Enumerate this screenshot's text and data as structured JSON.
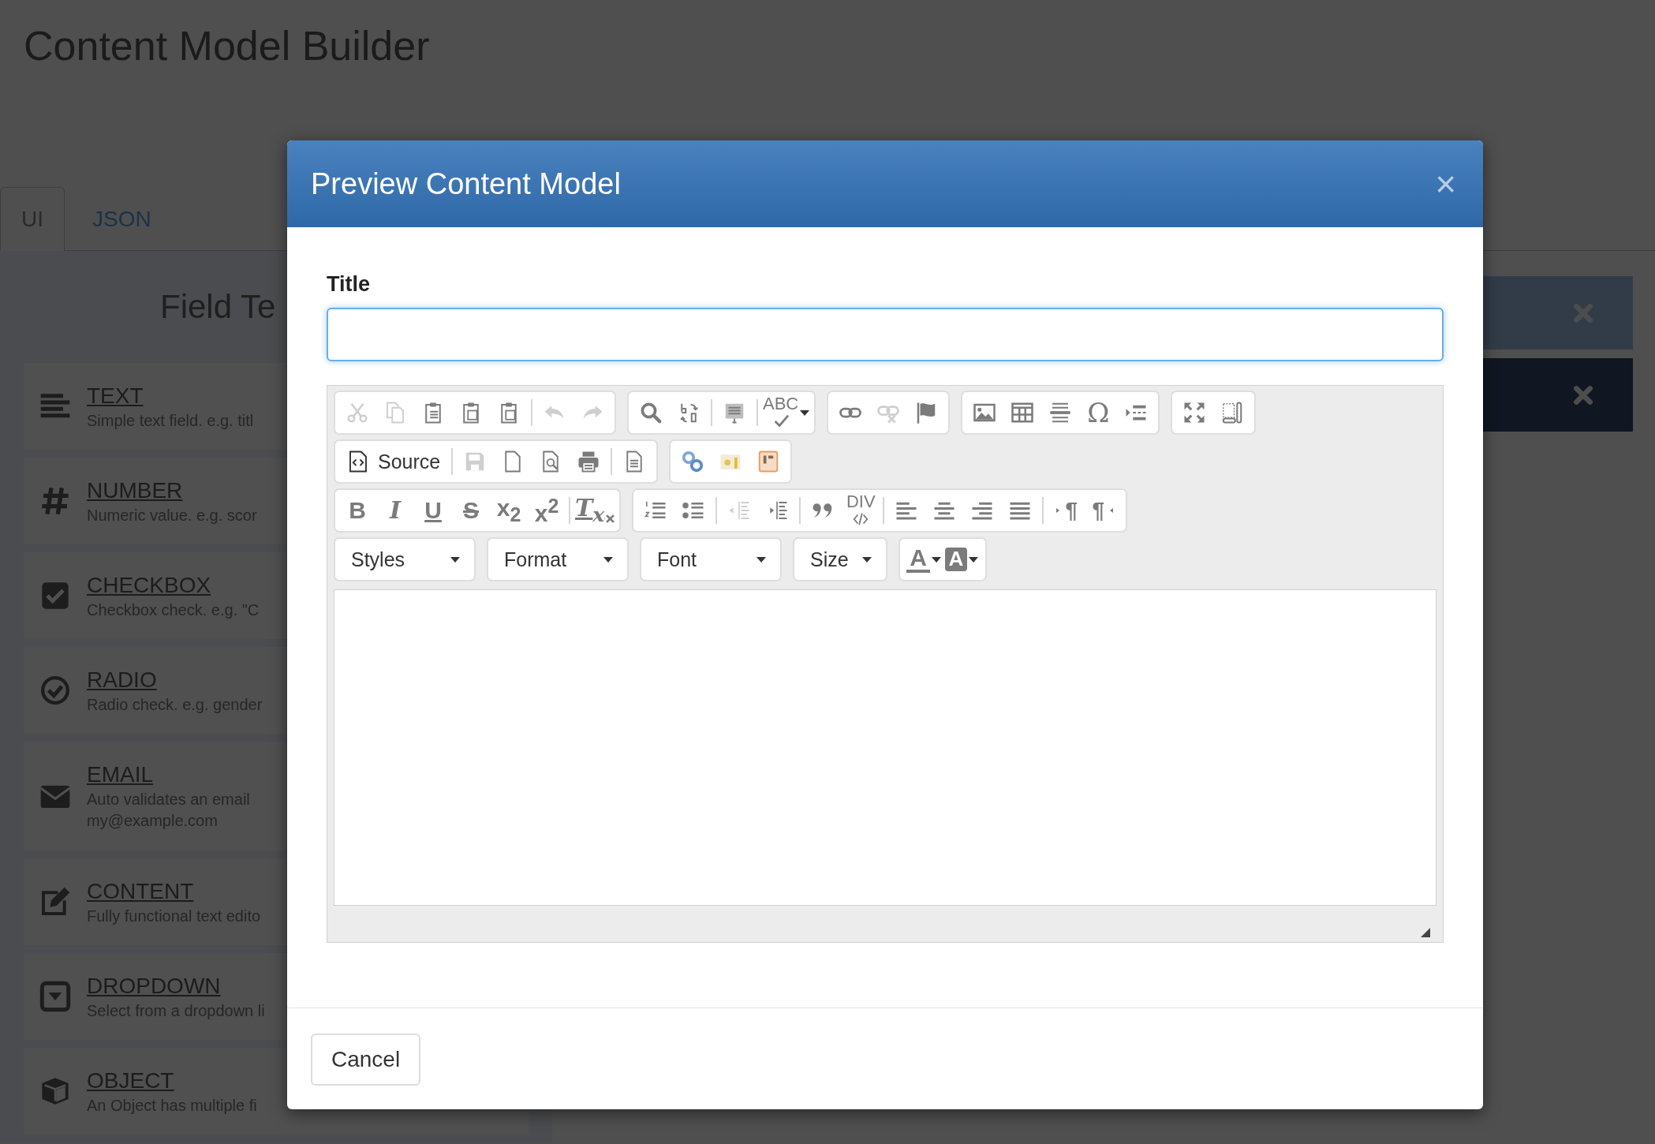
{
  "page": {
    "title": "Content Model Builder"
  },
  "tabs": [
    {
      "label": "UI",
      "selected": true
    },
    {
      "label": "JSON",
      "selected": false
    }
  ],
  "field_templates": {
    "heading": "Field Te",
    "items": [
      {
        "name": "TEXT",
        "description": [
          "Simple text field. e.g. titl"
        ]
      },
      {
        "name": "NUMBER",
        "description": [
          "Numeric value. e.g. scor"
        ]
      },
      {
        "name": "CHECKBOX",
        "description": [
          "Checkbox check. e.g. \"C"
        ]
      },
      {
        "name": "RADIO",
        "description": [
          "Radio check. e.g. gender"
        ]
      },
      {
        "name": "EMAIL",
        "description": [
          "Auto validates an email",
          "my@example.com"
        ]
      },
      {
        "name": "CONTENT",
        "description": [
          "Fully functional text edito"
        ]
      },
      {
        "name": "DROPDOWN",
        "description": [
          "Select from a dropdown li"
        ]
      },
      {
        "name": "OBJECT",
        "description": [
          "An Object has multiple fi"
        ]
      }
    ]
  },
  "side_panels": [
    {
      "color": "#323c48"
    },
    {
      "color": "#101722"
    }
  ],
  "modal": {
    "title": "Preview Content Model",
    "close": "×",
    "field_label": "Title",
    "toolbar": [
      [
        {
          "items": [
            {
              "kind": "button",
              "disabled": true
            },
            {
              "kind": "button",
              "disabled": true
            },
            {
              "kind": "button",
              "disabled": false
            },
            {
              "kind": "button",
              "disabled": false
            },
            {
              "kind": "button",
              "disabled": false
            },
            {
              "kind": "separator"
            },
            {
              "kind": "button",
              "disabled": true
            },
            {
              "kind": "button",
              "disabled": true
            }
          ]
        },
        {
          "items": [
            {
              "kind": "button",
              "disabled": false
            },
            {
              "kind": "button",
              "disabled": false
            },
            {
              "kind": "separator"
            },
            {
              "kind": "button",
              "disabled": false
            },
            {
              "kind": "separator"
            },
            {
              "kind": "menu-button",
              "disabled": false,
              "glyph": "ABC"
            }
          ]
        },
        {
          "items": [
            {
              "kind": "button",
              "disabled": false
            },
            {
              "kind": "button",
              "disabled": true
            },
            {
              "kind": "button",
              "disabled": false
            }
          ]
        },
        {
          "items": [
            {
              "kind": "button",
              "disabled": false
            },
            {
              "kind": "button",
              "disabled": false
            },
            {
              "kind": "button",
              "disabled": false
            },
            {
              "kind": "button",
              "disabled": false,
              "glyph": "Ω"
            },
            {
              "kind": "button",
              "disabled": false
            }
          ]
        },
        {
          "items": [
            {
              "kind": "button",
              "disabled": false
            },
            {
              "kind": "button",
              "disabled": false
            }
          ]
        }
      ],
      [
        {
          "items": [
            {
              "kind": "source",
              "disabled": false,
              "label": "Source"
            },
            {
              "kind": "separator"
            },
            {
              "kind": "button",
              "disabled": true
            },
            {
              "kind": "button",
              "disabled": false
            },
            {
              "kind": "button",
              "disabled": false
            },
            {
              "kind": "button",
              "disabled": false
            },
            {
              "kind": "separator"
            },
            {
              "kind": "button",
              "disabled": false
            }
          ]
        },
        {
          "items": [
            {
              "kind": "button",
              "disabled": false
            },
            {
              "kind": "button",
              "disabled": false
            },
            {
              "kind": "button",
              "disabled": false
            }
          ]
        }
      ],
      [
        {
          "items": [
            {
              "kind": "button",
              "disabled": false,
              "glyph": "B"
            },
            {
              "kind": "button",
              "disabled": false,
              "glyph": "I"
            },
            {
              "kind": "button",
              "disabled": false,
              "glyph": "U"
            },
            {
              "kind": "button",
              "disabled": false,
              "glyph": "S"
            },
            {
              "kind": "button",
              "disabled": false,
              "glyph": "x$_{2}$"
            },
            {
              "kind": "button",
              "disabled": false,
              "glyph": "x$^{2}$"
            },
            {
              "kind": "separator"
            },
            {
              "kind": "button",
              "disabled": false,
              "glyph": "T$_{x}$"
            }
          ]
        },
        {
          "items": [
            {
              "kind": "button",
              "disabled": false
            },
            {
              "kind": "button",
              "disabled": false
            },
            {
              "kind": "separator"
            },
            {
              "kind": "button",
              "disabled": true
            },
            {
              "kind": "button",
              "disabled": false
            },
            {
              "kind": "separator"
            },
            {
              "kind": "button",
              "disabled": false
            },
            {
              "kind": "button",
              "disabled": false,
              "glyph": "DIV"
            },
            {
              "kind": "separator"
            },
            {
              "kind": "button",
              "disabled": false
            },
            {
              "kind": "button",
              "disabled": false
            },
            {
              "kind": "button",
              "disabled": false
            },
            {
              "kind": "button",
              "disabled": false
            },
            {
              "kind": "separator"
            },
            {
              "kind": "button",
              "disabled": false,
              "glyph": "¶"
            },
            {
              "kind": "button",
              "disabled": false,
              "glyph": "¶"
            }
          ]
        }
      ],
      [
        {
          "items": [
            {
              "kind": "combo",
              "label": "Styles"
            }
          ]
        },
        {
          "items": [
            {
              "kind": "combo",
              "label": "Format"
            }
          ]
        },
        {
          "items": [
            {
              "kind": "combo",
              "label": "Font"
            }
          ]
        },
        {
          "items": [
            {
              "kind": "combo",
              "label": "Size"
            }
          ]
        },
        {
          "items": [
            {
              "kind": "color",
              "glyph": "A"
            },
            {
              "kind": "color",
              "glyph": "A"
            }
          ]
        }
      ]
    ],
    "cancel": "Cancel"
  }
}
